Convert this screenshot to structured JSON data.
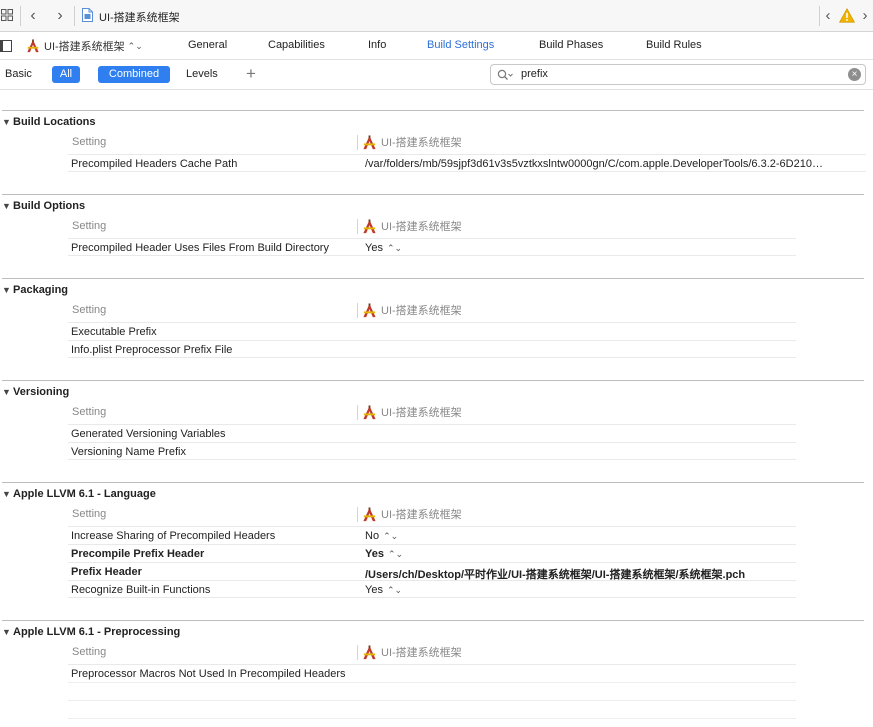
{
  "jumpbar": {
    "title": "UI-搭建系统框架",
    "back_glyph": "‹",
    "forward_glyph": "›",
    "issue_prev_glyph": "‹",
    "issue_next_glyph": "›"
  },
  "tabbar": {
    "target_label": "UI-搭建系统框架",
    "target_chevron": "⌃⌄",
    "tabs": [
      {
        "label": "General"
      },
      {
        "label": "Capabilities"
      },
      {
        "label": "Info"
      },
      {
        "label": "Build Settings"
      },
      {
        "label": "Build Phases"
      },
      {
        "label": "Build Rules"
      }
    ],
    "active_tab": "Build Settings"
  },
  "filterbar": {
    "basic_label": "Basic",
    "all_label": "All",
    "combined_label": "Combined",
    "levels_label": "Levels",
    "add_label": "+",
    "search_value": "prefix",
    "clear_label": "×"
  },
  "column_setting": "Setting",
  "column_target": "UI-搭建系统框架",
  "sections": [
    {
      "title": "Build Locations",
      "rows": [
        {
          "name": "Precompiled Headers Cache Path",
          "value": "/var/folders/mb/59sjpf3d61v3s5vztkxslntw0000gn/C/com.apple.DeveloperTools/6.3.2-6D210…"
        }
      ]
    },
    {
      "title": "Build Options",
      "rows": [
        {
          "name": "Precompiled Header Uses Files From Build Directory",
          "value": "Yes"
        }
      ]
    },
    {
      "title": "Packaging",
      "rows": [
        {
          "name": "Executable Prefix",
          "value": ""
        },
        {
          "name": "Info.plist Preprocessor Prefix File",
          "value": ""
        }
      ]
    },
    {
      "title": "Versioning",
      "rows": [
        {
          "name": "Generated Versioning Variables",
          "value": ""
        },
        {
          "name": "Versioning Name Prefix",
          "value": ""
        }
      ]
    },
    {
      "title": "Apple LLVM 6.1 - Language",
      "rows": [
        {
          "name": "Increase Sharing of Precompiled Headers",
          "value": "No"
        },
        {
          "name": "Precompile Prefix Header",
          "value": "Yes"
        },
        {
          "name": "Prefix Header",
          "value": "/Users/ch/Desktop/平时作业/UI-搭建系统框架/UI-搭建系统框架/系统框架.pch"
        },
        {
          "name": "Recognize Built-in Functions",
          "value": "Yes"
        }
      ]
    },
    {
      "title": "Apple LLVM 6.1 - Preprocessing",
      "rows": [
        {
          "name": "Preprocessor Macros Not Used In Precompiled Headers",
          "value": ""
        }
      ]
    }
  ],
  "stepper_glyph": "⌃⌄",
  "colors": {
    "accent": "#2f7ff0",
    "active_tab": "#2c6fd6",
    "warning": "#f2b400"
  },
  "icons": {
    "navigator": "grid-icon",
    "file": "project-file-icon",
    "target": "app-target-icon",
    "warning": "warning-icon",
    "search": "search-icon"
  }
}
